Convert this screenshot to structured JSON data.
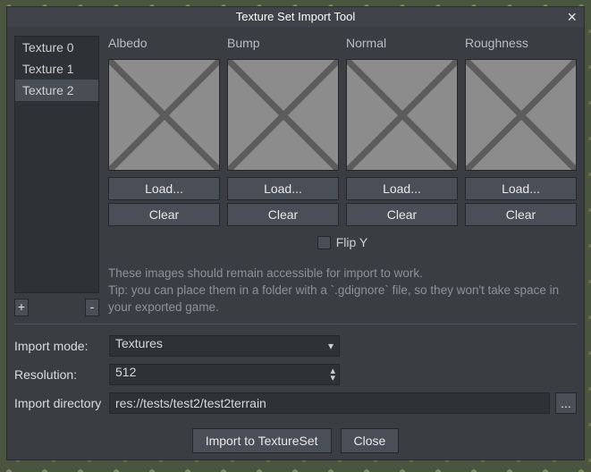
{
  "titlebar": {
    "title": "Texture Set Import Tool"
  },
  "textureList": {
    "items": [
      {
        "label": "Texture 0"
      },
      {
        "label": "Texture 1"
      },
      {
        "label": "Texture 2"
      }
    ],
    "addLabel": "+",
    "removeLabel": "-"
  },
  "slots": {
    "labels": {
      "albedo": "Albedo",
      "bump": "Bump",
      "normal": "Normal",
      "roughness": "Roughness"
    },
    "loadLabel": "Load...",
    "clearLabel": "Clear",
    "flipYLabel": "Flip Y"
  },
  "hints": {
    "line1": "These images should remain accessible for import to work.",
    "line2": "Tip: you can place them in a folder with a `.gdignore` file, so they won't take space in your exported game."
  },
  "form": {
    "importModeLabel": "Import mode:",
    "importModeValue": "Textures",
    "resolutionLabel": "Resolution:",
    "resolutionValue": "512",
    "importDirLabel": "Import directory",
    "importDirValue": "res://tests/test2/test2terrain",
    "browseLabel": "..."
  },
  "footer": {
    "importLabel": "Import to TextureSet",
    "closeLabel": "Close"
  }
}
